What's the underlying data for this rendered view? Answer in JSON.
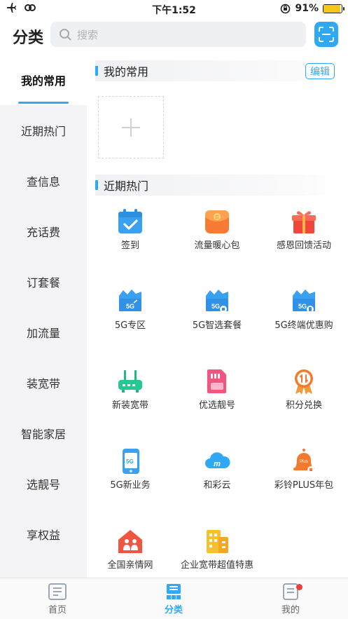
{
  "status_bar": {
    "time": "下午1:52",
    "battery": "91%"
  },
  "header": {
    "title": "分类",
    "search_placeholder": "搜索"
  },
  "sidebar": {
    "items": [
      {
        "label": "我的常用",
        "active": true
      },
      {
        "label": "近期热门"
      },
      {
        "label": "查信息"
      },
      {
        "label": "充话费"
      },
      {
        "label": "订套餐"
      },
      {
        "label": "加流量"
      },
      {
        "label": "装宽带"
      },
      {
        "label": "智能家居"
      },
      {
        "label": "选靓号"
      },
      {
        "label": "享权益"
      }
    ]
  },
  "favorites": {
    "title": "我的常用",
    "edit_label": "编辑"
  },
  "hot": {
    "title": "近期热门",
    "items": [
      {
        "label": "签到",
        "icon": "calendar-check-icon"
      },
      {
        "label": "流量暖心包",
        "icon": "gift-bag-icon"
      },
      {
        "label": "感恩回馈活动",
        "icon": "gift-box-icon"
      },
      {
        "label": "5G专区",
        "icon": "5g-cloud-icon"
      },
      {
        "label": "5G智选套餐",
        "icon": "5g-package-icon"
      },
      {
        "label": "5G终端优惠购",
        "icon": "5g-device-icon"
      },
      {
        "label": "新装宽带",
        "icon": "router-icon"
      },
      {
        "label": "优选靓号",
        "icon": "sim-card-icon"
      },
      {
        "label": "积分兑换",
        "icon": "points-medal-icon"
      },
      {
        "label": "5G新业务",
        "icon": "5g-phone-icon"
      },
      {
        "label": "和彩云",
        "icon": "cloud-icon"
      },
      {
        "label": "彩铃PLUS年包",
        "icon": "bell-plus-icon"
      },
      {
        "label": "全国亲情网",
        "icon": "family-house-icon"
      },
      {
        "label": "企业宽带超值特惠",
        "icon": "building-icon"
      }
    ]
  },
  "tabbar": {
    "items": [
      {
        "label": "首页",
        "icon": "home-icon"
      },
      {
        "label": "分类",
        "icon": "category-icon",
        "active": true
      },
      {
        "label": "我的",
        "icon": "profile-icon"
      }
    ]
  },
  "colors": {
    "accent": "#2fa9f3",
    "sidebar_bg": "#f4f4f6",
    "badge": "#f03e3e"
  }
}
